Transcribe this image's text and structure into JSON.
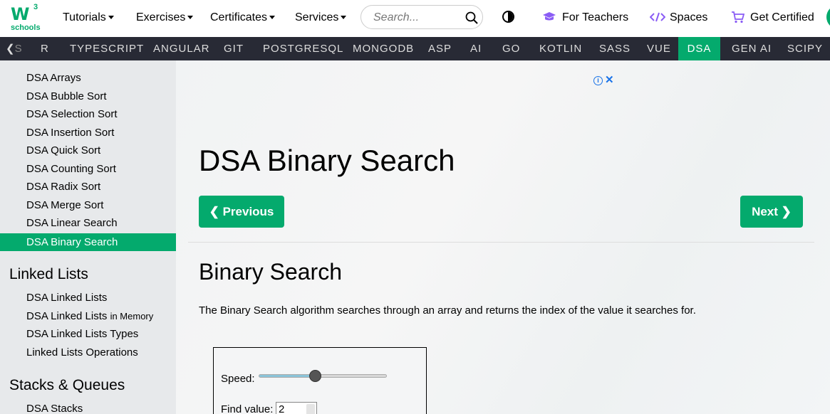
{
  "logo": {
    "mark": "W",
    "superscript": "3",
    "text": "schools"
  },
  "topnav": {
    "menus": [
      {
        "label": "Tutorials"
      },
      {
        "label": "Exercises"
      },
      {
        "label": "Certificates"
      },
      {
        "label": "Services"
      }
    ],
    "search_placeholder": "Search...",
    "links": [
      {
        "label": "For Teachers",
        "icon": "graduation-cap-icon"
      },
      {
        "label": "Spaces",
        "icon": "code-icon"
      },
      {
        "label": "Get Certified",
        "icon": "cart-icon"
      }
    ]
  },
  "subnav": {
    "arrow": "❮",
    "partial": "S",
    "items": [
      "R",
      "TYPESCRIPT",
      "ANGULAR",
      "GIT",
      "POSTGRESQL",
      "MONGODB",
      "ASP",
      "AI",
      "GO",
      "KOTLIN",
      "SASS",
      "VUE",
      "DSA",
      "GEN AI",
      "SCIPY"
    ],
    "active": "DSA"
  },
  "sidebar": {
    "sorting_items": [
      "DSA Arrays",
      "DSA Bubble Sort",
      "DSA Selection Sort",
      "DSA Insertion Sort",
      "DSA Quick Sort",
      "DSA Counting Sort",
      "DSA Radix Sort",
      "DSA Merge Sort",
      "DSA Linear Search",
      "DSA Binary Search"
    ],
    "active_item": "DSA Binary Search",
    "linked_lists_heading": "Linked Lists",
    "linked_lists_items": [
      "DSA Linked Lists",
      "DSA Linked Lists",
      "DSA Linked Lists Types",
      "Linked Lists Operations"
    ],
    "linked_lists_memory_suffix": "in Memory",
    "stacks_heading": "Stacks & Queues",
    "stacks_items": [
      "DSA Stacks"
    ]
  },
  "main": {
    "ad_info": "i",
    "ad_close": "✕",
    "title": "DSA Binary Search",
    "prev_label": "❮ Previous",
    "next_label": "Next ❯",
    "section_title": "Binary Search",
    "intro": "The Binary Search algorithm searches through an array and returns the index of the value it searches for.",
    "demo": {
      "speed_label": "Speed:",
      "speed_fraction": 0.43,
      "find_label": "Find value:",
      "find_value": "2"
    }
  },
  "colors": {
    "accent": "#04AA6D",
    "subnav_bg": "#282A35",
    "sidebar_bg": "#E7E9EB"
  }
}
